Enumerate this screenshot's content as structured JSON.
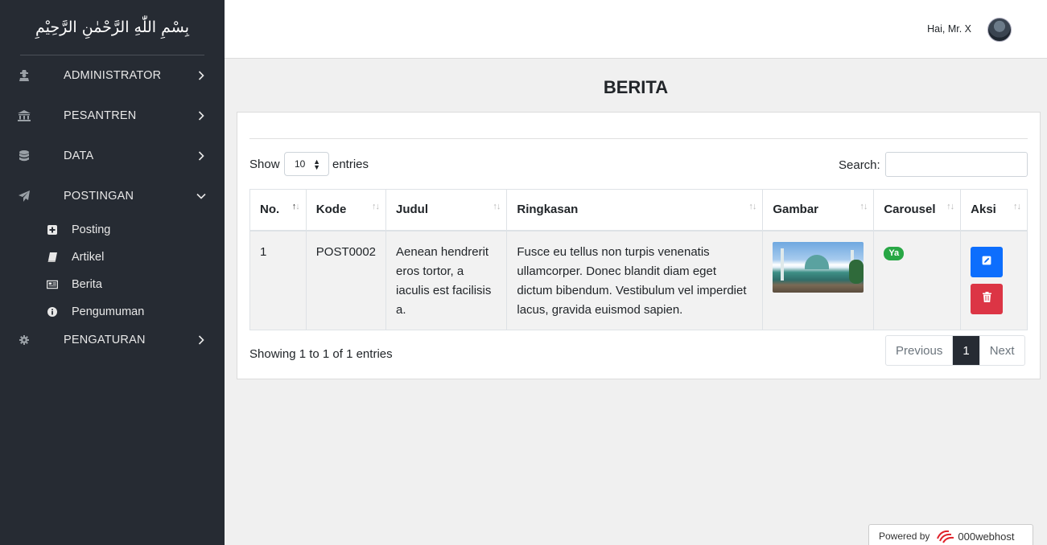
{
  "sidebar": {
    "brand": "بِسْمِ اللّٰهِ الرَّحْمٰنِ الرَّحِيْمِ",
    "items": [
      {
        "label": "ADMINISTRATOR",
        "icon": "user-secret-icon"
      },
      {
        "label": "PESANTREN",
        "icon": "university-icon"
      },
      {
        "label": "DATA",
        "icon": "database-icon"
      },
      {
        "label": "POSTINGAN",
        "icon": "paper-plane-icon",
        "expanded": true
      },
      {
        "label": "PENGATURAN",
        "icon": "gear-icon"
      }
    ],
    "sub_items": [
      {
        "label": "Posting",
        "icon": "plus-square-icon"
      },
      {
        "label": "Artikel",
        "icon": "book-icon"
      },
      {
        "label": "Berita",
        "icon": "newspaper-icon"
      },
      {
        "label": "Pengumuman",
        "icon": "info-circle-icon"
      }
    ]
  },
  "topbar": {
    "greeting": "Hai, Mr. X"
  },
  "main": {
    "title": "BERITA",
    "show_label": "Show",
    "page_length": "10",
    "entries_label": "entries",
    "search_label": "Search:",
    "search_value": "",
    "columns": [
      "No.",
      "Kode",
      "Judul",
      "Ringkasan",
      "Gambar",
      "Carousel",
      "Aksi"
    ],
    "rows": [
      {
        "no": "1",
        "kode": "POST0002",
        "judul": "Aenean hendrerit eros tortor, a iaculis est facilisis a.",
        "ringkasan": "Fusce eu tellus non turpis venenatis ullamcorper. Donec blandit diam eget dictum bibendum. Vestibulum vel imperdiet lacus, gravida euismod sapien.",
        "carousel": "Ya"
      }
    ],
    "info": "Showing 1 to 1 of 1 entries",
    "pagination": {
      "previous": "Previous",
      "current": "1",
      "next": "Next"
    }
  },
  "footer": {
    "powered_by": "Powered by",
    "host": "000webhost"
  },
  "colors": {
    "sidebar_bg": "#262b33",
    "primary": "#0d6efd",
    "danger": "#dc3545",
    "success": "#28a745"
  }
}
